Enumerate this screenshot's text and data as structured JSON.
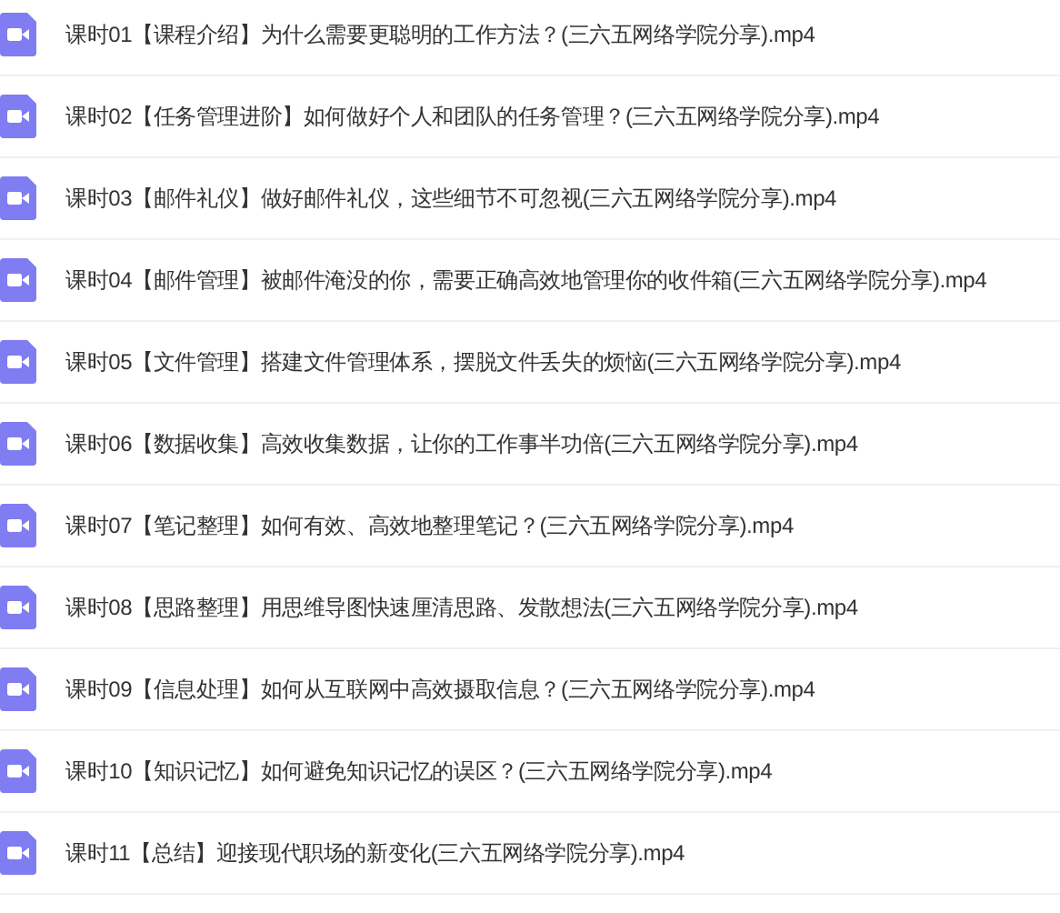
{
  "files": [
    {
      "name": "课时01【课程介绍】为什么需要更聪明的工作方法？(三六五网络学院分享).mp4"
    },
    {
      "name": "课时02【任务管理进阶】如何做好个人和团队的任务管理？(三六五网络学院分享).mp4"
    },
    {
      "name": "课时03【邮件礼仪】做好邮件礼仪，这些细节不可忽视(三六五网络学院分享).mp4"
    },
    {
      "name": "课时04【邮件管理】被邮件淹没的你，需要正确高效地管理你的收件箱(三六五网络学院分享).mp4"
    },
    {
      "name": "课时05【文件管理】搭建文件管理体系，摆脱文件丢失的烦恼(三六五网络学院分享).mp4"
    },
    {
      "name": "课时06【数据收集】高效收集数据，让你的工作事半功倍(三六五网络学院分享).mp4"
    },
    {
      "name": "课时07【笔记整理】如何有效、高效地整理笔记？(三六五网络学院分享).mp4"
    },
    {
      "name": "课时08【思路整理】用思维导图快速厘清思路、发散想法(三六五网络学院分享).mp4"
    },
    {
      "name": "课时09【信息处理】如何从互联网中高效摄取信息？(三六五网络学院分享).mp4"
    },
    {
      "name": "课时10【知识记忆】如何避免知识记忆的误区？(三六五网络学院分享).mp4"
    },
    {
      "name": "课时11【总结】迎接现代职场的新变化(三六五网络学院分享).mp4"
    }
  ]
}
